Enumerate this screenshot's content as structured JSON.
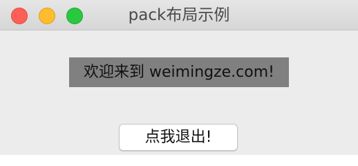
{
  "window": {
    "title": "pack布局示例"
  },
  "main": {
    "welcome_label": "欢迎来到 weimingze.com!",
    "quit_button_label": "点我退出!"
  },
  "colors": {
    "close": "#fe5f57",
    "minimize": "#febc2e",
    "zoom": "#28c840",
    "label_background": "#808080",
    "window_background": "#ececec"
  }
}
